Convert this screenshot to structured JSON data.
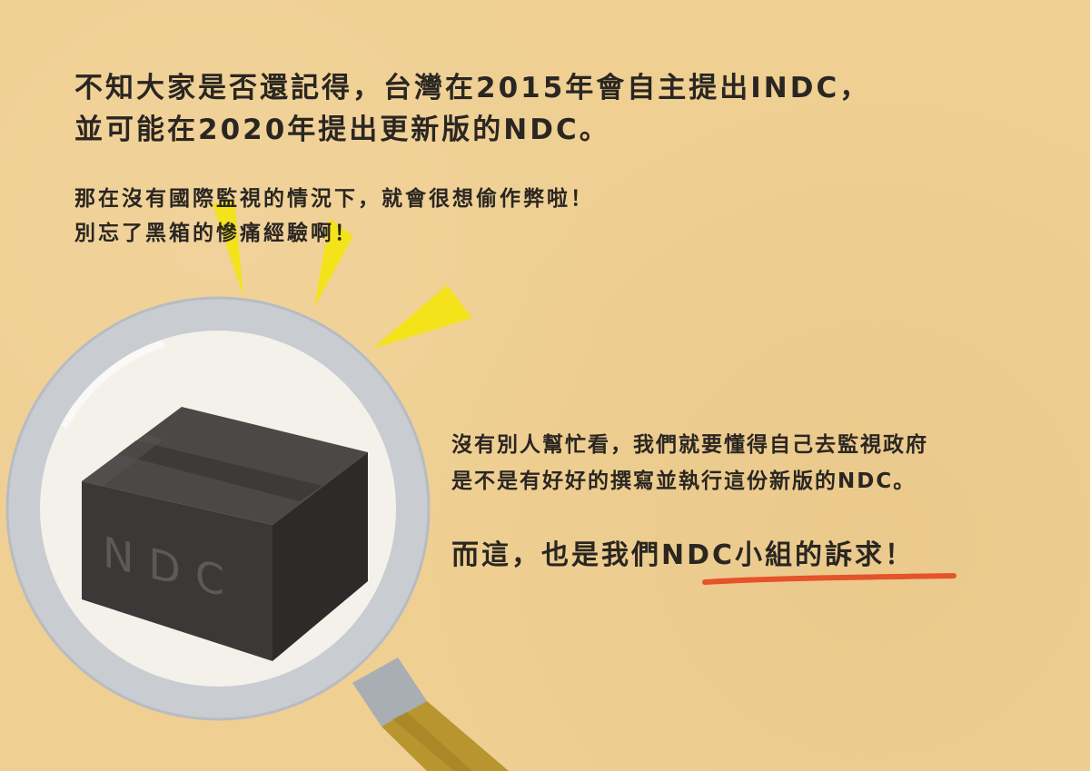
{
  "intro": {
    "line1": "不知大家是否還記得，台灣在2015年會自主提出INDC，",
    "line2": "並可能在2020年提出更新版的NDC。"
  },
  "warning": {
    "line1": "那在沒有國際監視的情況下，就會很想偷作弊啦！",
    "line2": "別忘了黑箱的慘痛經驗啊！"
  },
  "illustration": {
    "box_label": "NDC",
    "icon": "magnifying-glass-icon",
    "box_icon": "black-box-icon"
  },
  "call_to_action": {
    "line1": "沒有別人幫忙看，我們就要懂得自己去監視政府",
    "line2": "是不是有好好的撰寫並執行這份新版的NDC。"
  },
  "slogan": {
    "prefix": "而這，也是我們",
    "highlight": "NDC小組",
    "suffix": "的訴求！"
  },
  "colors": {
    "background": "#efcf92",
    "text": "#2a2622",
    "highlight_underline": "#e5532a",
    "rays": "#f4e31b",
    "box": "#3a3937",
    "lens_rim": "#c9ccd1",
    "handle": "#b8952f"
  }
}
